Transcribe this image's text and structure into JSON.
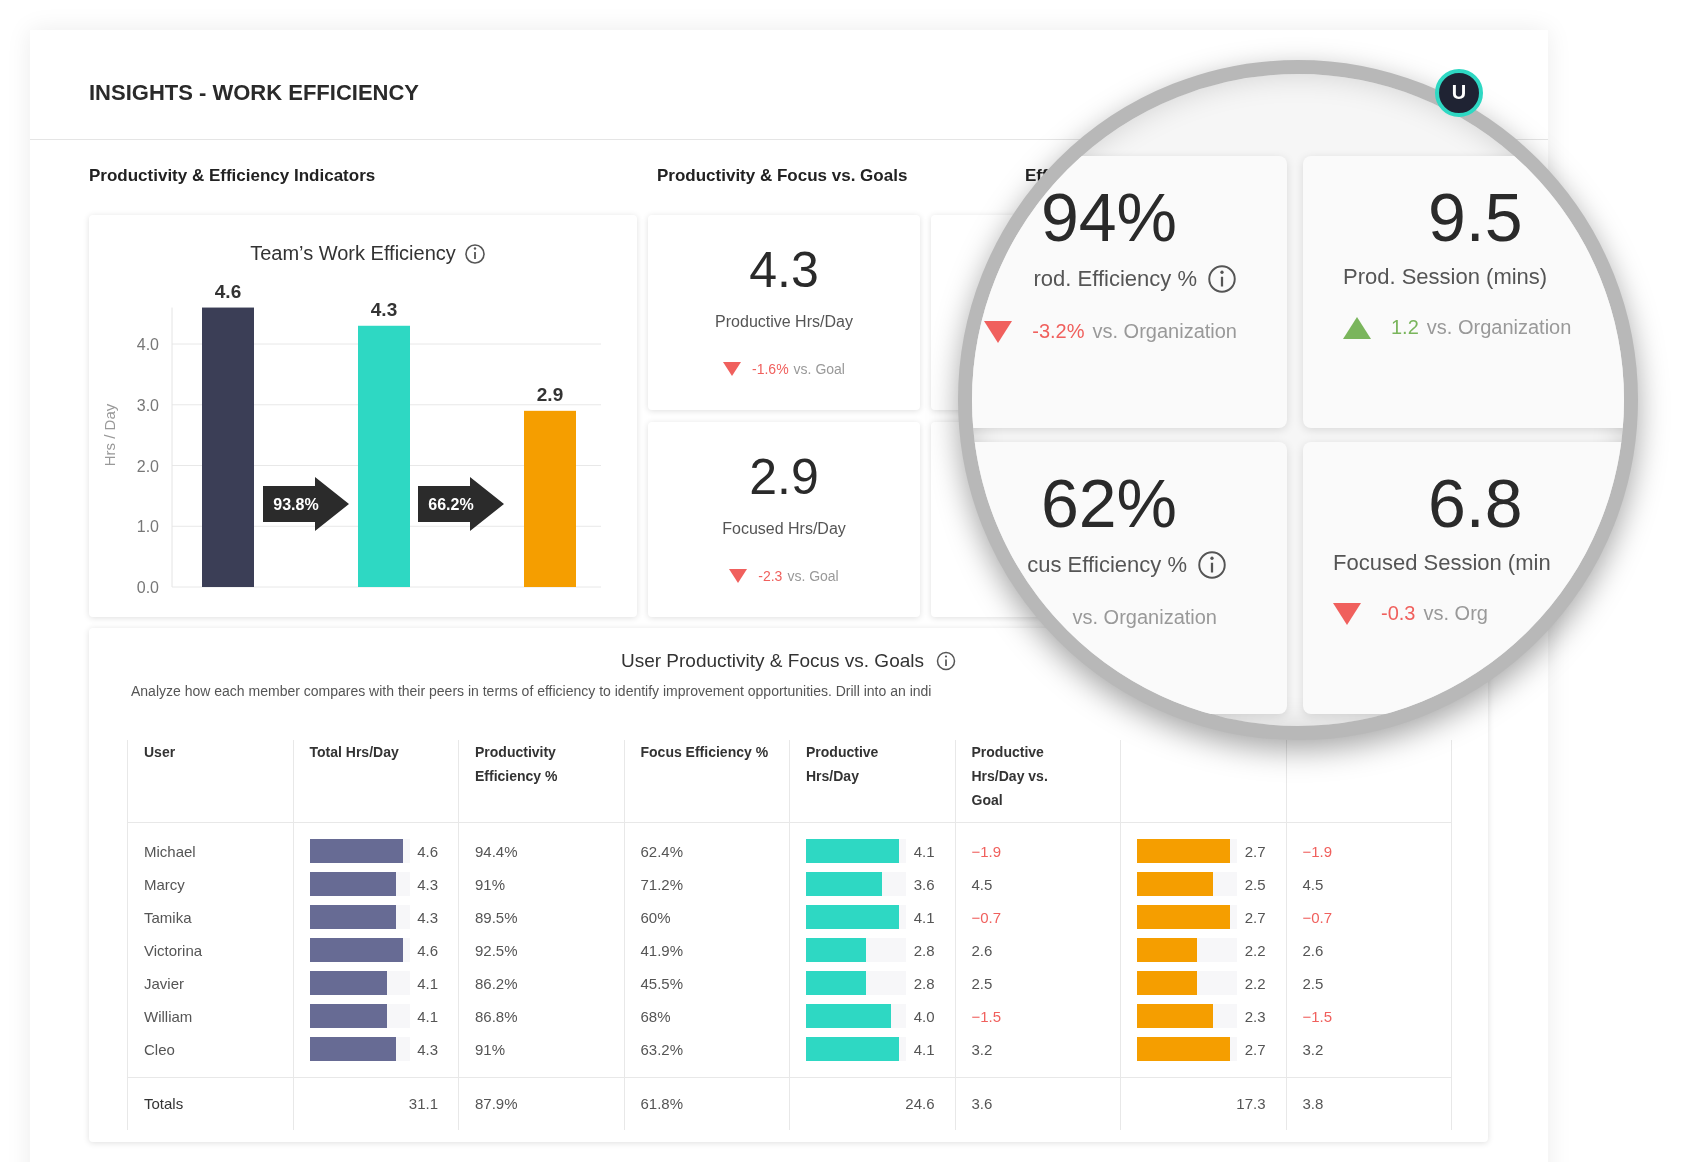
{
  "header": {
    "title": "INSIGHTS - WORK EFFICIENCY",
    "avatar": "U"
  },
  "indicators": {
    "heading": "Productivity & Efficiency Indicators",
    "card_title": "Team’s Work Efficiency",
    "chart_data": {
      "type": "bar",
      "ylabel": "Hrs / Day",
      "values": [
        4.6,
        4.3,
        2.9
      ],
      "colors": [
        "#3b3e56",
        "#2ed8c3",
        "#f59e00"
      ],
      "ylim": [
        0,
        4.6
      ],
      "grid": true,
      "yticks": [
        {
          "value": 0,
          "label": "0.0"
        },
        {
          "value": 1,
          "label": "1.0"
        },
        {
          "value": 2,
          "label": "2.0"
        },
        {
          "value": 3,
          "label": "3.0"
        },
        {
          "value": 4,
          "label": "4.0"
        }
      ],
      "data_labels": true,
      "annotations": [
        "93.8%",
        "66.2%"
      ]
    }
  },
  "goals": {
    "heading": "Productivity & Focus vs. Goals",
    "cards": [
      {
        "value": "4.3",
        "label": "Productive Hrs/Day",
        "declined": true,
        "delta": "-1.6%",
        "delta_text": "vs. Goal"
      },
      {
        "value": "2.9",
        "label": "Focused Hrs/Day",
        "declined": true,
        "delta": "-2.3",
        "delta_text": "vs. Goal"
      }
    ]
  },
  "efficiency": {
    "heading": "Eff",
    "magnified_cards": [
      {
        "value": "94%",
        "label": "rod. Efficiency %",
        "info": true,
        "declined": true,
        "delta": "-3.2%",
        "delta_text": "vs. Organization"
      },
      {
        "value": "9.5",
        "label": "Prod. Session (mins)",
        "info": false,
        "declined": false,
        "delta": "1.2",
        "delta_text": "vs. Organization"
      },
      {
        "value": "62%",
        "label": "cus Efficiency %",
        "info": true,
        "delta_text": "vs. Organization"
      },
      {
        "value": "6.8",
        "label": "Focused Session (min",
        "info": false,
        "declined": true,
        "delta": "-0.3",
        "delta_text": "vs. Org"
      }
    ]
  },
  "table": {
    "title": "User Productivity & Focus vs. Goals",
    "description": "Analyze how each member compares with their peers in terms of efficiency to identify improvement opportunities. Drill into an indi",
    "columns": [
      "User",
      "Total Hrs/Day",
      "Productivity Efficiency %",
      "Focus Efficiency %",
      "Productive Hrs/Day",
      "Productive Hrs/Day vs. Goal"
    ],
    "rows": [
      {
        "user": "Michael",
        "total": {
          "value": "4.6",
          "level": 0.93
        },
        "prod_eff": "94.4%",
        "focus_eff": "62.4%",
        "productive": {
          "value": "4.1",
          "level": 0.93
        },
        "prod_vs_goal": {
          "value": "−1.9",
          "below_goal": true
        },
        "column_7": {
          "value": "2.7",
          "level": 0.93
        },
        "column_8": {
          "value": "−1.9",
          "below_goal": true
        }
      },
      {
        "user": "Marcy",
        "total": {
          "value": "4.3",
          "level": 0.86
        },
        "prod_eff": "91%",
        "focus_eff": "71.2%",
        "productive": {
          "value": "3.6",
          "level": 0.76
        },
        "prod_vs_goal": {
          "value": "4.5",
          "below_goal": false
        },
        "column_7": {
          "value": "2.5",
          "level": 0.76
        },
        "column_8": {
          "value": "4.5",
          "below_goal": false
        }
      },
      {
        "user": "Tamika",
        "total": {
          "value": "4.3",
          "level": 0.86
        },
        "prod_eff": "89.5%",
        "focus_eff": "60%",
        "productive": {
          "value": "4.1",
          "level": 0.93
        },
        "prod_vs_goal": {
          "value": "−0.7",
          "below_goal": true
        },
        "column_7": {
          "value": "2.7",
          "level": 0.93
        },
        "column_8": {
          "value": "−0.7",
          "below_goal": true
        }
      },
      {
        "user": "Victorina",
        "total": {
          "value": "4.6",
          "level": 0.93
        },
        "prod_eff": "92.5%",
        "focus_eff": "41.9%",
        "productive": {
          "value": "2.8",
          "level": 0.6
        },
        "prod_vs_goal": {
          "value": "2.6",
          "below_goal": false
        },
        "column_7": {
          "value": "2.2",
          "level": 0.6
        },
        "column_8": {
          "value": "2.6",
          "below_goal": false
        }
      },
      {
        "user": "Javier",
        "total": {
          "value": "4.1",
          "level": 0.77
        },
        "prod_eff": "86.2%",
        "focus_eff": "45.5%",
        "productive": {
          "value": "2.8",
          "level": 0.6
        },
        "prod_vs_goal": {
          "value": "2.5",
          "below_goal": false
        },
        "column_7": {
          "value": "2.2",
          "level": 0.6
        },
        "column_8": {
          "value": "2.5",
          "below_goal": false
        }
      },
      {
        "user": "William",
        "total": {
          "value": "4.1",
          "level": 0.77
        },
        "prod_eff": "86.8%",
        "focus_eff": "68%",
        "productive": {
          "value": "4.0",
          "level": 0.85
        },
        "prod_vs_goal": {
          "value": "−1.5",
          "below_goal": true
        },
        "column_7": {
          "value": "2.3",
          "level": 0.76
        },
        "column_8": {
          "value": "−1.5",
          "below_goal": true
        }
      },
      {
        "user": "Cleo",
        "total": {
          "value": "4.3",
          "level": 0.86
        },
        "prod_eff": "91%",
        "focus_eff": "63.2%",
        "productive": {
          "value": "4.1",
          "level": 0.93
        },
        "prod_vs_goal": {
          "value": "3.2",
          "below_goal": false
        },
        "column_7": {
          "value": "2.7",
          "level": 0.93
        },
        "column_8": {
          "value": "3.2",
          "below_goal": false
        }
      }
    ],
    "totals": {
      "label": "Totals",
      "total": "31.1",
      "prod_eff": "87.9%",
      "focus_eff": "61.8%",
      "productive": "24.6",
      "prod_vs_goal": "3.6",
      "column_7": "17.3",
      "column_8": "3.8"
    }
  }
}
